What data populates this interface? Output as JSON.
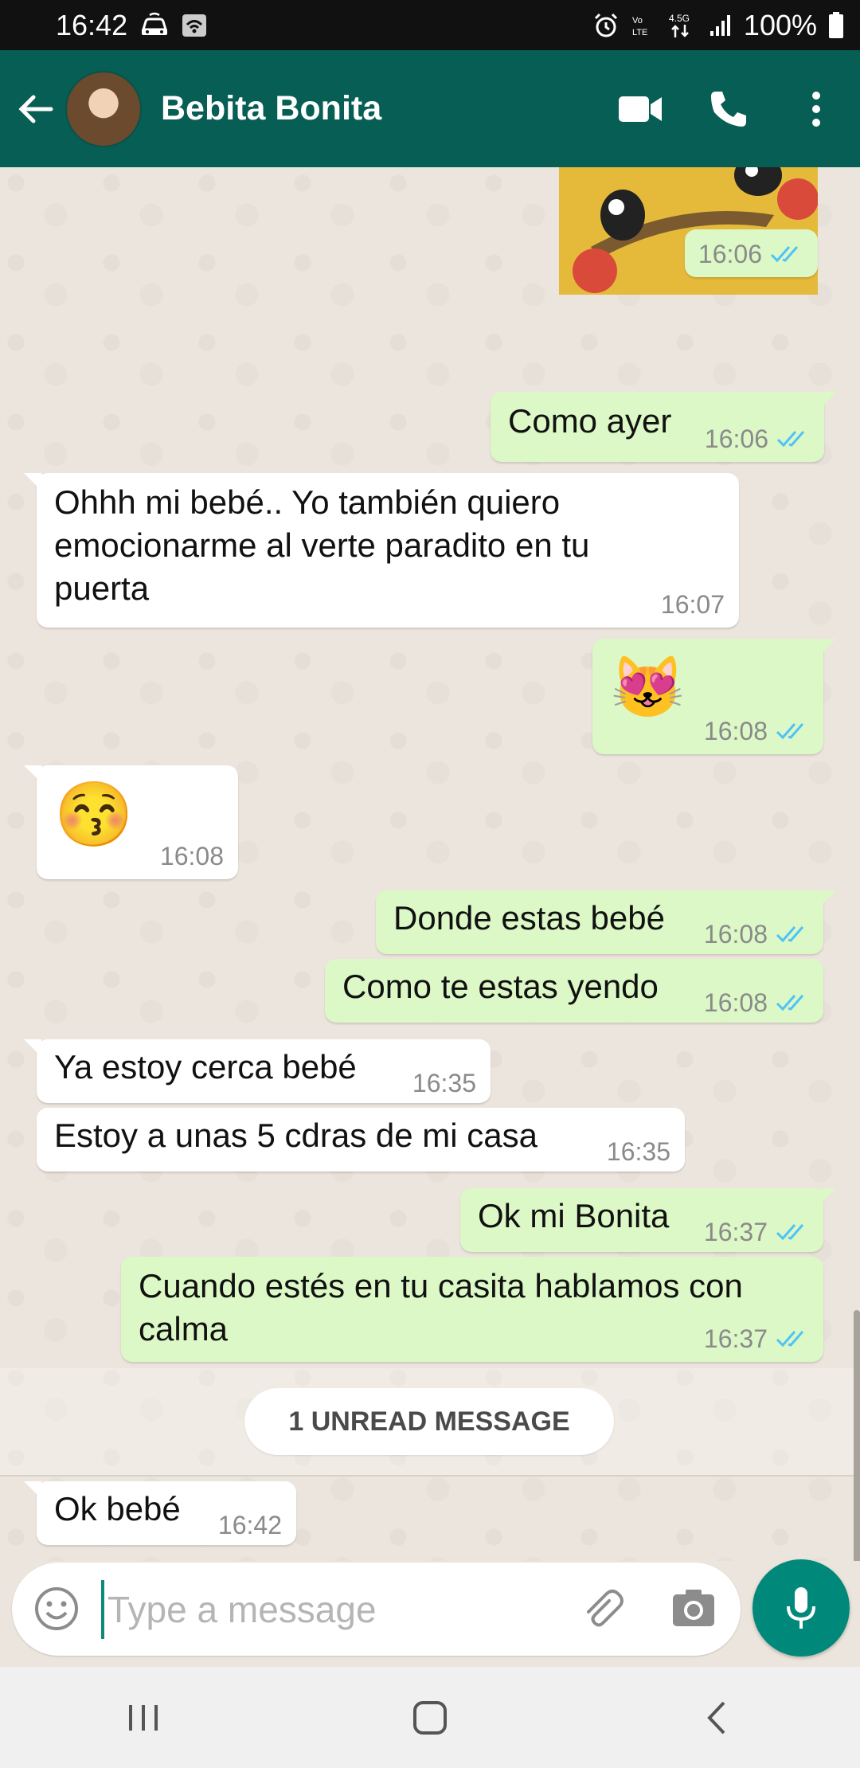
{
  "status_bar": {
    "time": "16:42",
    "network": "4.5G",
    "battery": "100%",
    "left_icons": [
      "car-icon",
      "wifi-box-icon"
    ],
    "right_icons": [
      "alarm-icon",
      "volte-icon",
      "data-arrows-icon",
      "signal-icon",
      "battery-icon"
    ]
  },
  "header": {
    "contact_name": "Bebita Bonita",
    "actions": [
      "video-call-icon",
      "phone-icon",
      "more-options-icon"
    ]
  },
  "messages": [
    {
      "dir": "out",
      "text": "",
      "time": "16:06",
      "type": "sticker-time"
    },
    {
      "dir": "out",
      "text": "Como ayer",
      "time": "16:06"
    },
    {
      "dir": "in",
      "text": "Ohhh mi bebé.. Yo también quiero emocionarme al verte paradito en tu puerta",
      "time": "16:07"
    },
    {
      "dir": "out",
      "text": "😻",
      "time": "16:08"
    },
    {
      "dir": "in",
      "text": "😚",
      "time": "16:08"
    },
    {
      "dir": "out",
      "text": "Donde estas bebé",
      "time": "16:08"
    },
    {
      "dir": "out",
      "text": "Como te estas yendo",
      "time": "16:08"
    },
    {
      "dir": "in",
      "text": "Ya estoy cerca bebé",
      "time": "16:35"
    },
    {
      "dir": "in",
      "text": "Estoy a unas 5 cdras de mi casa",
      "time": "16:35"
    },
    {
      "dir": "out",
      "text": "Ok mi Bonita",
      "time": "16:37"
    },
    {
      "dir": "out",
      "text": "Cuando estés en tu casita hablamos con calma",
      "time": "16:37"
    },
    {
      "dir": "in",
      "text": "Ok bebé",
      "time": "16:42"
    }
  ],
  "unread_label": "1 UNREAD MESSAGE",
  "composer": {
    "placeholder": "Type a message"
  },
  "colors": {
    "header": "#075e54",
    "outgoing_bubble": "#dcf8c6",
    "incoming_bubble": "#ffffff",
    "read_ticks": "#4fc3f7",
    "mic_button": "#00897b"
  }
}
